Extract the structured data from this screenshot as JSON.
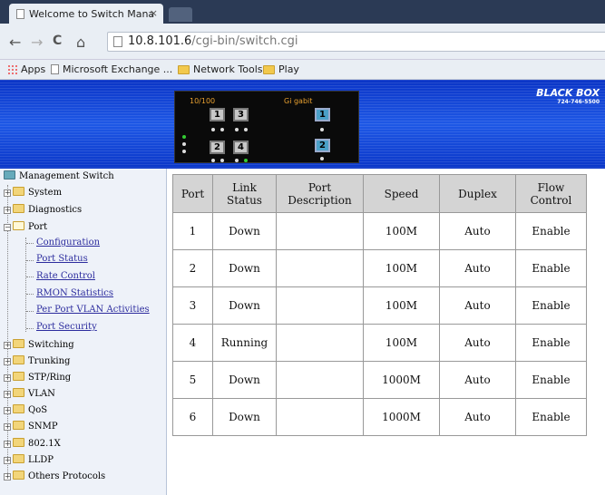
{
  "browser": {
    "tab_title": "Welcome to Switch Mana",
    "tab_close": "×",
    "back": "←",
    "forward": "→",
    "reload": "C",
    "home": "⌂",
    "url_host": "10.8.101.6",
    "url_path": "/cgi-bin/switch.cgi",
    "bookmarks": [
      "Apps",
      "Microsoft Exchange ...",
      "Network Tools",
      "Play"
    ]
  },
  "banner": {
    "speed_label": "10/100",
    "gigabit_label": "Gi gabit",
    "ports_fe": [
      "1",
      "3",
      "2",
      "4"
    ],
    "ports_gb": [
      "1",
      "2"
    ],
    "logo_text": "BLACK BOX",
    "logo_phone": "724-746-5500"
  },
  "sidebar": {
    "root": "Management Switch",
    "items": [
      "System",
      "Diagnostics",
      "Port",
      "Switching",
      "Trunking",
      "STP/Ring",
      "VLAN",
      "QoS",
      "SNMP",
      "802.1X",
      "LLDP",
      "Others Protocols"
    ],
    "port_children": [
      "Configuration",
      "Port Status",
      "Rate Control",
      "RMON Statistics",
      "Per Port VLAN Activities",
      "Port Security"
    ]
  },
  "table": {
    "headers": [
      "Port",
      "Link Status",
      "Port Description",
      "Speed",
      "Duplex",
      "Flow Control"
    ],
    "rows": [
      [
        "1",
        "Down",
        "",
        "100M",
        "Auto",
        "Enable"
      ],
      [
        "2",
        "Down",
        "",
        "100M",
        "Auto",
        "Enable"
      ],
      [
        "3",
        "Down",
        "",
        "100M",
        "Auto",
        "Enable"
      ],
      [
        "4",
        "Running",
        "",
        "100M",
        "Auto",
        "Enable"
      ],
      [
        "5",
        "Down",
        "",
        "1000M",
        "Auto",
        "Enable"
      ],
      [
        "6",
        "Down",
        "",
        "1000M",
        "Auto",
        "Enable"
      ]
    ]
  },
  "colors": {
    "banner_blue": "#1e58e6",
    "header_gray": "#d4d4d4",
    "link_blue": "#2c2c9e"
  }
}
